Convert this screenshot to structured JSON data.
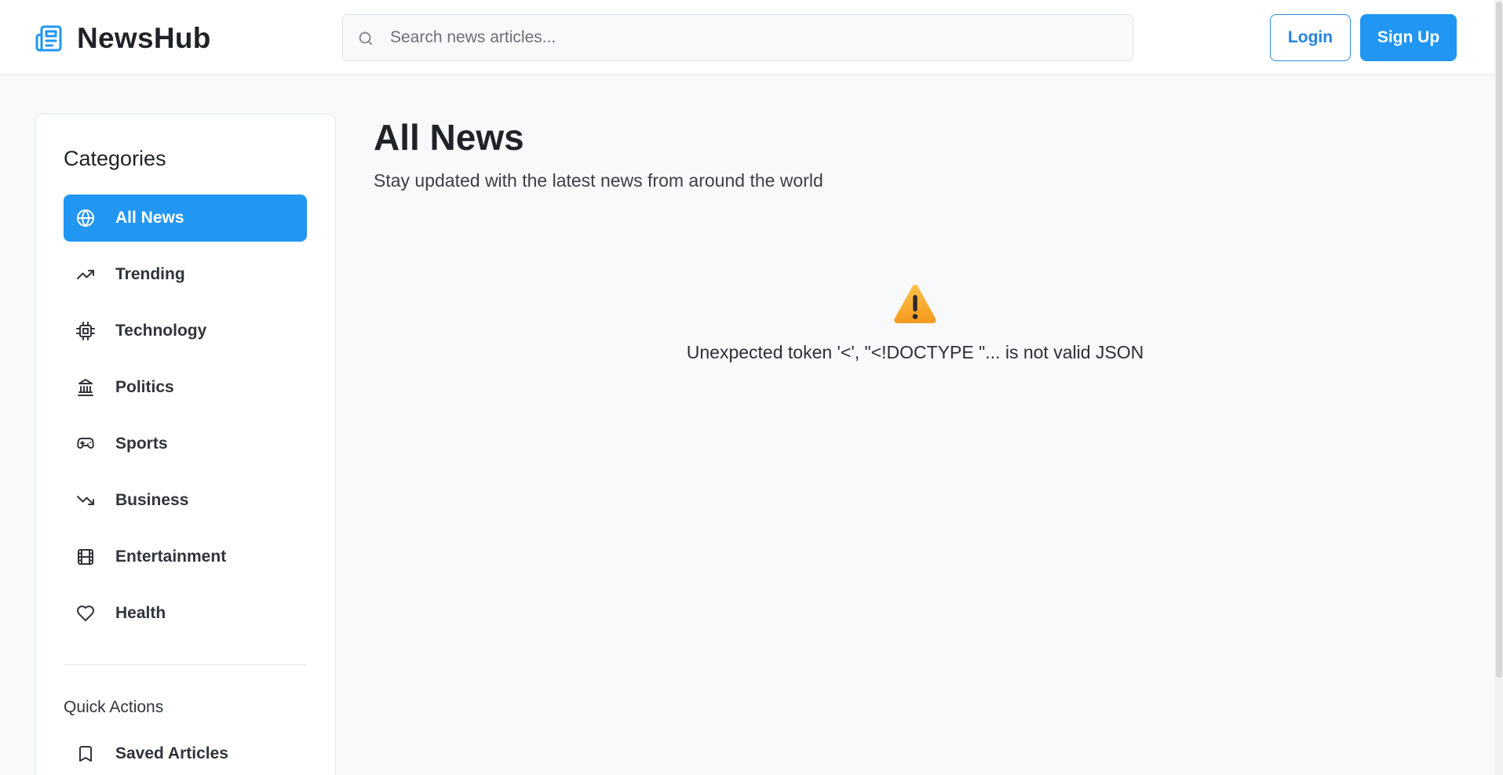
{
  "header": {
    "brand_name": "NewsHub",
    "brand_icon": "newspaper-icon",
    "search": {
      "placeholder": "Search news articles...",
      "value": "",
      "icon": "search-icon"
    },
    "login_label": "Login",
    "signup_label": "Sign Up"
  },
  "sidebar": {
    "title": "Categories",
    "items": [
      {
        "label": "All News",
        "icon": "globe-icon",
        "active": true
      },
      {
        "label": "Trending",
        "icon": "trending-up-icon",
        "active": false
      },
      {
        "label": "Technology",
        "icon": "cpu-icon",
        "active": false
      },
      {
        "label": "Politics",
        "icon": "landmark-icon",
        "active": false
      },
      {
        "label": "Sports",
        "icon": "gamepad-icon",
        "active": false
      },
      {
        "label": "Business",
        "icon": "trending-down-icon",
        "active": false
      },
      {
        "label": "Entertainment",
        "icon": "film-icon",
        "active": false
      },
      {
        "label": "Health",
        "icon": "heart-icon",
        "active": false
      }
    ],
    "quick_actions_title": "Quick Actions",
    "quick_actions": [
      {
        "label": "Saved Articles",
        "icon": "bookmark-icon"
      }
    ]
  },
  "main": {
    "title": "All News",
    "subtitle": "Stay updated with the latest news from around the world",
    "error_icon": "warning-icon",
    "error_message": "Unexpected token '<', \"<!DOCTYPE \"... is not valid JSON"
  },
  "colors": {
    "accent": "#2196f3",
    "background": "#f8f9fb",
    "text": "#1f2328",
    "warning": "#f5a623"
  }
}
